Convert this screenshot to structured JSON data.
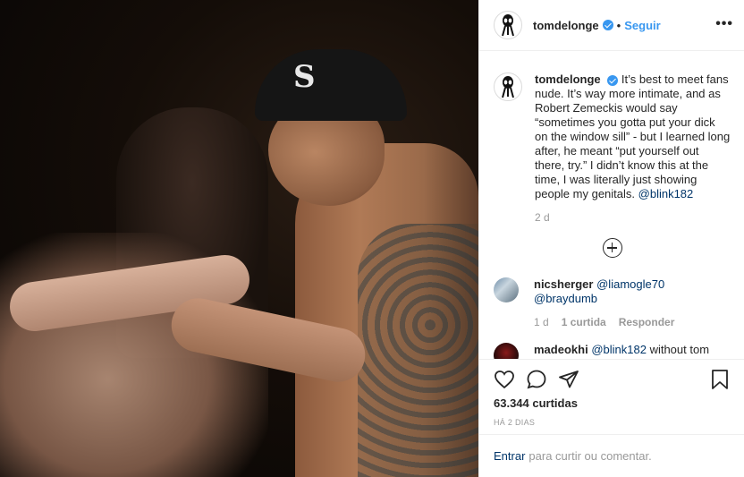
{
  "post": {
    "photo_alt": "",
    "cap_logo": "S"
  },
  "header": {
    "username": "tomdelonge",
    "separator": "•",
    "follow_label": "Seguir",
    "more_label": "•••"
  },
  "caption": {
    "username": "tomdelonge",
    "text": "It’s best to meet fans nude. It’s way more intimate, and as Robert Zemeckis would say “sometimes you gotta put your dick on the window sill” - but I learned long after, he meant “put yourself out there, try.” I didn’t know this at the time, I was literally just showing people my genitals.",
    "mention": "@blink182",
    "time": "2 d"
  },
  "comments": [
    {
      "username": "nicsherger",
      "mentions": [
        "@liamogle70",
        "@braydumb"
      ],
      "time": "1 d",
      "likes_label": "1 curtida",
      "reply_label": "Responder"
    },
    {
      "username": "madeokhi",
      "mention": "@blink182",
      "text": "without tom"
    }
  ],
  "actions": {
    "likes": "63.344 curtidas",
    "timestamp": "HÁ 2 DIAS"
  },
  "add_comment": {
    "login_label": "Entrar",
    "rest_label": "para curtir ou comentar."
  },
  "colors": {
    "accent": "#3897f0",
    "link": "#003569",
    "muted": "#999999",
    "border": "#efefef"
  }
}
